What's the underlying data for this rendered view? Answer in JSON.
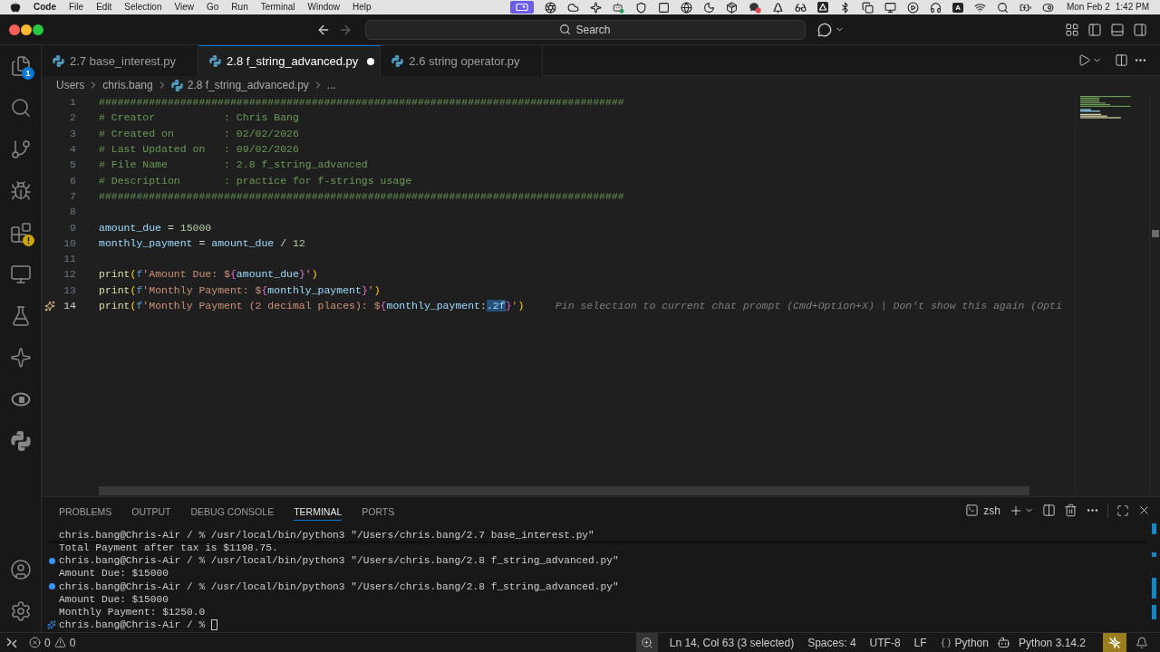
{
  "menubar": {
    "app": "Code",
    "menus": [
      "File",
      "Edit",
      "Selection",
      "View",
      "Go",
      "Run",
      "Terminal",
      "Window",
      "Help"
    ],
    "input_source": "A",
    "date": "Mon Feb 2",
    "time": "1:42 PM"
  },
  "command_center": {
    "label": "Search"
  },
  "activity_bar": {
    "items": [
      {
        "kind": "explorer",
        "badge": "1",
        "warning": false
      },
      {
        "kind": "search",
        "warning": false
      },
      {
        "kind": "source-control",
        "warning": false
      },
      {
        "kind": "run-debug",
        "warning": false
      },
      {
        "kind": "extensions",
        "warning": true
      },
      {
        "kind": "remote",
        "warning": false
      },
      {
        "kind": "testing",
        "warning": false
      },
      {
        "kind": "chat",
        "warning": false
      },
      {
        "kind": "r-language",
        "warning": false
      },
      {
        "kind": "python",
        "warning": false
      }
    ],
    "bottom": [
      {
        "kind": "accounts"
      },
      {
        "kind": "settings"
      }
    ]
  },
  "tabs": [
    {
      "label": "2.7 base_interest.py",
      "selected": false,
      "modified": false
    },
    {
      "label": "2.8 f_string_advanced.py",
      "selected": true,
      "modified": true
    },
    {
      "label": "2.6 string operator.py",
      "selected": false,
      "modified": false
    }
  ],
  "breadcrumb": [
    {
      "label": "Users",
      "kind": "folder"
    },
    {
      "label": "chris.bang",
      "kind": "folder"
    },
    {
      "label": "2.8 f_string_advanced.py",
      "kind": "file"
    },
    {
      "label": "...",
      "kind": "symbol"
    }
  ],
  "editor": {
    "lines": [
      {
        "number": "1",
        "current": false,
        "tokens": [
          {
            "text": "####################################################################################",
            "kind": "comment"
          }
        ]
      },
      {
        "number": "2",
        "current": false,
        "tokens": [
          {
            "text": "# Creator           : Chris Bang",
            "kind": "comment"
          }
        ]
      },
      {
        "number": "3",
        "current": false,
        "tokens": [
          {
            "text": "# Created on        : 02/02/2026",
            "kind": "comment"
          }
        ]
      },
      {
        "number": "4",
        "current": false,
        "tokens": [
          {
            "text": "# Last Updated on   : 09/02/2026",
            "kind": "comment"
          }
        ]
      },
      {
        "number": "5",
        "current": false,
        "tokens": [
          {
            "text": "# File Name         : 2.8 f_string_advanced",
            "kind": "comment"
          }
        ]
      },
      {
        "number": "6",
        "current": false,
        "tokens": [
          {
            "text": "# Description       : practice for f-strings usage",
            "kind": "comment"
          }
        ]
      },
      {
        "number": "7",
        "current": false,
        "tokens": [
          {
            "text": "####################################################################################",
            "kind": "comment"
          }
        ]
      },
      {
        "number": "8",
        "current": false
      },
      {
        "number": "9",
        "current": false,
        "tokens": [
          {
            "text": "amount_due",
            "kind": "variable"
          },
          {
            "text": " = ",
            "kind": "operator"
          },
          {
            "text": "15000",
            "kind": "number"
          }
        ]
      },
      {
        "number": "10",
        "current": false,
        "tokens": [
          {
            "text": "monthly_payment",
            "kind": "variable"
          },
          {
            "text": " = ",
            "kind": "operator"
          },
          {
            "text": "amount_due",
            "kind": "variable"
          },
          {
            "text": " / ",
            "kind": "operator"
          },
          {
            "text": "12",
            "kind": "number"
          }
        ]
      },
      {
        "number": "11",
        "current": false
      },
      {
        "number": "12",
        "current": false,
        "tokens": [
          {
            "text": "print",
            "kind": "function"
          },
          {
            "text": "(",
            "kind": "paren"
          },
          {
            "text": "f",
            "kind": "prefix"
          },
          {
            "text": "'Amount Due: $",
            "kind": "string"
          },
          {
            "text": "{",
            "kind": "brace"
          },
          {
            "text": "amount_due",
            "kind": "variable"
          },
          {
            "text": "}",
            "kind": "brace"
          },
          {
            "text": "'",
            "kind": "string"
          },
          {
            "text": ")",
            "kind": "paren"
          }
        ]
      },
      {
        "number": "13",
        "current": false,
        "tokens": [
          {
            "text": "print",
            "kind": "function"
          },
          {
            "text": "(",
            "kind": "paren"
          },
          {
            "text": "f",
            "kind": "prefix"
          },
          {
            "text": "'Monthly Payment: $",
            "kind": "string"
          },
          {
            "text": "{",
            "kind": "brace"
          },
          {
            "text": "monthly_payment",
            "kind": "variable"
          },
          {
            "text": "}",
            "kind": "brace"
          },
          {
            "text": "'",
            "kind": "string"
          },
          {
            "text": ")",
            "kind": "paren"
          }
        ]
      },
      {
        "number": "14",
        "current": true,
        "tokens": [
          {
            "text": "print",
            "kind": "function"
          },
          {
            "text": "(",
            "kind": "paren"
          },
          {
            "text": "f",
            "kind": "prefix"
          },
          {
            "text": "'Monthly Payment (2 decimal places): $",
            "kind": "string"
          },
          {
            "text": "{",
            "kind": "brace"
          },
          {
            "text": "monthly_payment",
            "kind": "variable"
          },
          {
            "text": ":",
            "kind": "operator"
          },
          {
            "text": ".2f",
            "kind": "selection"
          },
          {
            "text": "}",
            "kind": "brace"
          },
          {
            "text": "'",
            "kind": "string"
          },
          {
            "text": ")",
            "kind": "paren"
          }
        ],
        "hint": "Pin selection to current chat prompt (Cmd+Option+X) | Don't show this again (Opti"
      }
    ]
  },
  "panel": {
    "tabs": [
      {
        "label": "PROBLEMS",
        "selected": false
      },
      {
        "label": "OUTPUT",
        "selected": false
      },
      {
        "label": "DEBUG CONSOLE",
        "selected": false
      },
      {
        "label": "TERMINAL",
        "selected": true
      },
      {
        "label": "PORTS",
        "selected": false
      }
    ],
    "shell": "zsh",
    "terminal": [
      {
        "text": "chris.bang@Chris-Air / % /usr/local/bin/python3 \"/Users/chris.bang/2.7 base_interest.py\"",
        "kind": "sticky"
      },
      {
        "text": "Total Payment after tax is $1198.75.",
        "kind": "output"
      },
      {
        "text": "chris.bang@Chris-Air / % /usr/local/bin/python3 \"/Users/chris.bang/2.8 f_string_advanced.py\"",
        "kind": "command"
      },
      {
        "text": "Amount Due: $15000",
        "kind": "output"
      },
      {
        "text": "chris.bang@Chris-Air / % /usr/local/bin/python3 \"/Users/chris.bang/2.8 f_string_advanced.py\"",
        "kind": "command"
      },
      {
        "text": "Amount Due: $15000",
        "kind": "output"
      },
      {
        "text": "Monthly Payment: $1250.0",
        "kind": "output"
      },
      {
        "text": "chris.bang@Chris-Air / %",
        "kind": "prompt"
      }
    ]
  },
  "status_bar": {
    "errors": "0",
    "warnings": "0",
    "items": [
      {
        "kind": "position",
        "text": "Ln 14, Col 63 (3 selected)"
      },
      {
        "kind": "indent",
        "text": "Spaces: 4"
      },
      {
        "kind": "encoding",
        "text": "UTF-8"
      },
      {
        "kind": "eol",
        "text": "LF"
      },
      {
        "kind": "language",
        "text": "Python"
      },
      {
        "kind": "interpreter",
        "text": "Python 3.14.2"
      }
    ]
  }
}
